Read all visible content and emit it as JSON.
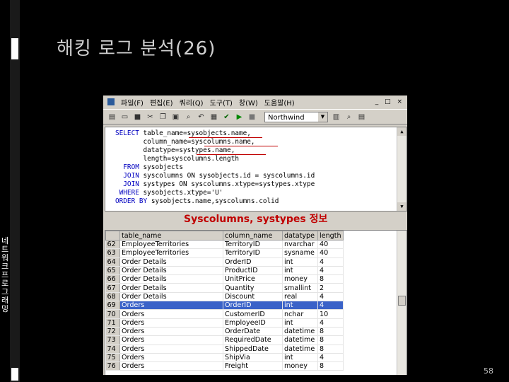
{
  "slide": {
    "title": "해킹 로그 분석(26)",
    "vertical_label": "네트워크 프로그래밍",
    "page_number": "58",
    "caption": "Syscolumns, systypes 정보"
  },
  "menu": {
    "items": [
      "파일(F)",
      "편집(E)",
      "쿼리(Q)",
      "도구(T)",
      "창(W)",
      "도움말(H)"
    ],
    "window_controls": "_ □ ×"
  },
  "toolbar": {
    "database": "Northwind"
  },
  "sql": {
    "lines": [
      {
        "kw": "SELECT ",
        "txt": "table_name=sysobjects.name,"
      },
      {
        "kw": "       ",
        "txt": "column_name=syscolumns.name,"
      },
      {
        "kw": "       ",
        "txt": "datatype=systypes.name,"
      },
      {
        "kw": "       ",
        "txt": "length=syscolumns.length"
      },
      {
        "kw": "  FROM ",
        "txt": "sysobjects"
      },
      {
        "kw": "  JOIN ",
        "txt": "syscolumns ON sysobjects.id = syscolumns.id"
      },
      {
        "kw": "  JOIN ",
        "txt": "systypes ON syscolumns.xtype=systypes.xtype"
      },
      {
        "kw": " WHERE ",
        "txt": "sysobjects.xtype='U'"
      },
      {
        "kw": "ORDER BY ",
        "txt": "sysobjects.name,syscolumns.colid"
      }
    ]
  },
  "results": {
    "headers": [
      "",
      "table_name",
      "column_name",
      "datatype",
      "length"
    ],
    "rows": [
      [
        "62",
        "EmployeeTerritories",
        "TerritoryID",
        "nvarchar",
        "40"
      ],
      [
        "63",
        "EmployeeTerritories",
        "TerritoryID",
        "sysname",
        "40"
      ],
      [
        "64",
        "Order Details",
        "OrderID",
        "int",
        "4"
      ],
      [
        "65",
        "Order Details",
        "ProductID",
        "int",
        "4"
      ],
      [
        "66",
        "Order Details",
        "UnitPrice",
        "money",
        "8"
      ],
      [
        "67",
        "Order Details",
        "Quantity",
        "smallint",
        "2"
      ],
      [
        "68",
        "Order Details",
        "Discount",
        "real",
        "4"
      ],
      [
        "69",
        "Orders",
        "OrderID",
        "int",
        "4"
      ],
      [
        "70",
        "Orders",
        "CustomerID",
        "nchar",
        "10"
      ],
      [
        "71",
        "Orders",
        "EmployeeID",
        "int",
        "4"
      ],
      [
        "72",
        "Orders",
        "OrderDate",
        "datetime",
        "8"
      ],
      [
        "73",
        "Orders",
        "RequiredDate",
        "datetime",
        "8"
      ],
      [
        "74",
        "Orders",
        "ShippedDate",
        "datetime",
        "8"
      ],
      [
        "75",
        "Orders",
        "ShipVia",
        "int",
        "4"
      ],
      [
        "76",
        "Orders",
        "Freight",
        "money",
        "8"
      ]
    ],
    "selected_index": 7
  }
}
